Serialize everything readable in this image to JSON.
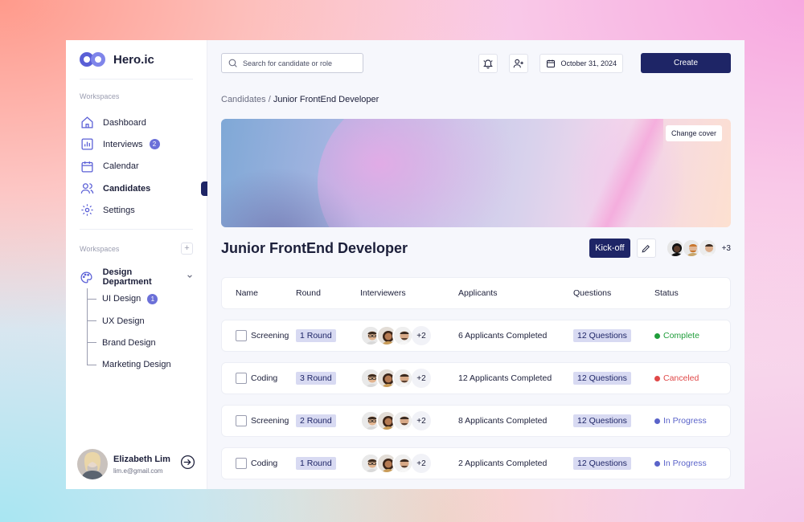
{
  "brand": {
    "name": "Hero.ic"
  },
  "sidebar": {
    "section1_label": "Workspaces",
    "items": [
      {
        "label": "Dashboard",
        "icon": "home-icon"
      },
      {
        "label": "Interviews",
        "icon": "chart-icon",
        "badge": "2"
      },
      {
        "label": "Calendar",
        "icon": "calendar-icon"
      },
      {
        "label": "Candidates",
        "icon": "users-icon",
        "active": true
      },
      {
        "label": "Settings",
        "icon": "gear-icon"
      }
    ],
    "section2_label": "Workspaces",
    "group": {
      "label": "Design Department",
      "icon": "palette-icon"
    },
    "sub_items": [
      {
        "label": "UI Design",
        "badge": "1"
      },
      {
        "label": "UX Design"
      },
      {
        "label": "Brand Design"
      },
      {
        "label": "Marketing Design"
      }
    ],
    "user": {
      "name": "Elizabeth Lim",
      "email": "lim.e@gmail.com"
    }
  },
  "topbar": {
    "search_placeholder": "Search for candidate or role",
    "date": "October 31, 2024",
    "create_label": "Create"
  },
  "breadcrumb": {
    "parent": "Candidates",
    "separator": " / ",
    "current": "Junior FrontEnd Developer"
  },
  "cover": {
    "change_label": "Change cover"
  },
  "page": {
    "title": "Junior FrontEnd Developer",
    "kickoff_label": "Kick-off",
    "team_more": "+3"
  },
  "table": {
    "headers": [
      "Name",
      "Round",
      "Interviewers",
      "Applicants",
      "Questions",
      "Status"
    ],
    "rows": [
      {
        "name": "Screening",
        "round": "1 Round",
        "more": "+2",
        "applicants": "6 Applicants Completed",
        "questions": "12 Questions",
        "status": "Complete",
        "status_color": "#1f9d3a"
      },
      {
        "name": "Coding",
        "round": "3 Round",
        "more": "+2",
        "applicants": "12 Applicants Completed",
        "questions": "12 Questions",
        "status": "Canceled",
        "status_color": "#e04848"
      },
      {
        "name": "Screening",
        "round": "2 Round",
        "more": "+2",
        "applicants": "8 Applicants Completed",
        "questions": "12 Questions",
        "status": "In Progress",
        "status_color": "#5a63c9"
      },
      {
        "name": "Coding",
        "round": "1 Round",
        "more": "+2",
        "applicants": "2 Applicants Completed",
        "questions": "12 Questions",
        "status": "In Progress",
        "status_color": "#5a63c9"
      }
    ]
  },
  "colors": {
    "primary": "#1e2566",
    "accent": "#6b70d8",
    "pill": "#d8daf2"
  }
}
